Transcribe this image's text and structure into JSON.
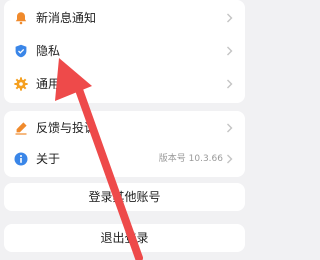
{
  "settings_group_1": {
    "items": [
      {
        "label": "新消息通知",
        "icon": "bell-icon",
        "icon_color": "#f08a2c"
      },
      {
        "label": "隐私",
        "icon": "shield-icon",
        "icon_color": "#3a86e8"
      },
      {
        "label": "通用",
        "icon": "gear-icon",
        "icon_color": "#f5a020"
      }
    ]
  },
  "settings_group_2": {
    "items": [
      {
        "label": "反馈与投诉",
        "icon": "pencil-icon",
        "icon_color": "#f08a2c"
      },
      {
        "label": "关于",
        "icon": "info-icon",
        "icon_color": "#3a86e8",
        "value": "版本号 10.3.66"
      }
    ]
  },
  "actions": {
    "switch_account": "登录其他账号",
    "logout": "退出登录"
  },
  "annotation": {
    "type": "arrow",
    "color": "#ee4a4a",
    "target": "隐私"
  }
}
